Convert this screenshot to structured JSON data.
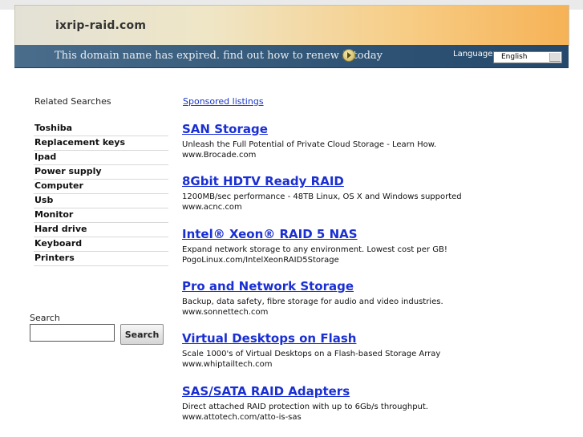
{
  "header": {
    "site_name": "ixrip-raid.com",
    "expired_notice": "This domain name has expired. find out how to renew it today",
    "language_label": "Language:",
    "language_value": "English"
  },
  "sidebar": {
    "title": "Related Searches",
    "items": [
      "Toshiba",
      "Replacement keys",
      "Ipad",
      "Power supply",
      "Computer",
      "Usb",
      "Monitor",
      "Hard drive",
      "Keyboard",
      "Printers"
    ]
  },
  "search": {
    "label": "Search",
    "value": "",
    "button_label": "Search"
  },
  "sponsored_label": "Sponsored listings",
  "listings": [
    {
      "title": "SAN Storage",
      "description": "Unleash the Full Potential of Private Cloud Storage - Learn How.",
      "url": "www.Brocade.com"
    },
    {
      "title": "8Gbit HDTV Ready RAID",
      "description": "1200MB/sec performance - 48TB Linux, OS X and Windows supported",
      "url": "www.acnc.com"
    },
    {
      "title": "Intel® Xeon® RAID 5 NAS",
      "description": "Expand network storage to any environment. Lowest cost per GB!",
      "url": "PogoLinux.com/IntelXeonRAID5Storage"
    },
    {
      "title": "Pro and Network Storage",
      "description": "Backup, data safety, fibre storage for audio and video industries.",
      "url": "www.sonnettech.com"
    },
    {
      "title": "Virtual Desktops on Flash",
      "description": "Scale 1000's of Virtual Desktops on a Flash-based Storage Array",
      "url": "www.whiptailtech.com"
    },
    {
      "title": "SAS/SATA RAID Adapters",
      "description": "Direct attached RAID protection with up to 6Gb/s throughput.",
      "url": "www.attotech.com/atto-is-sas"
    }
  ]
}
